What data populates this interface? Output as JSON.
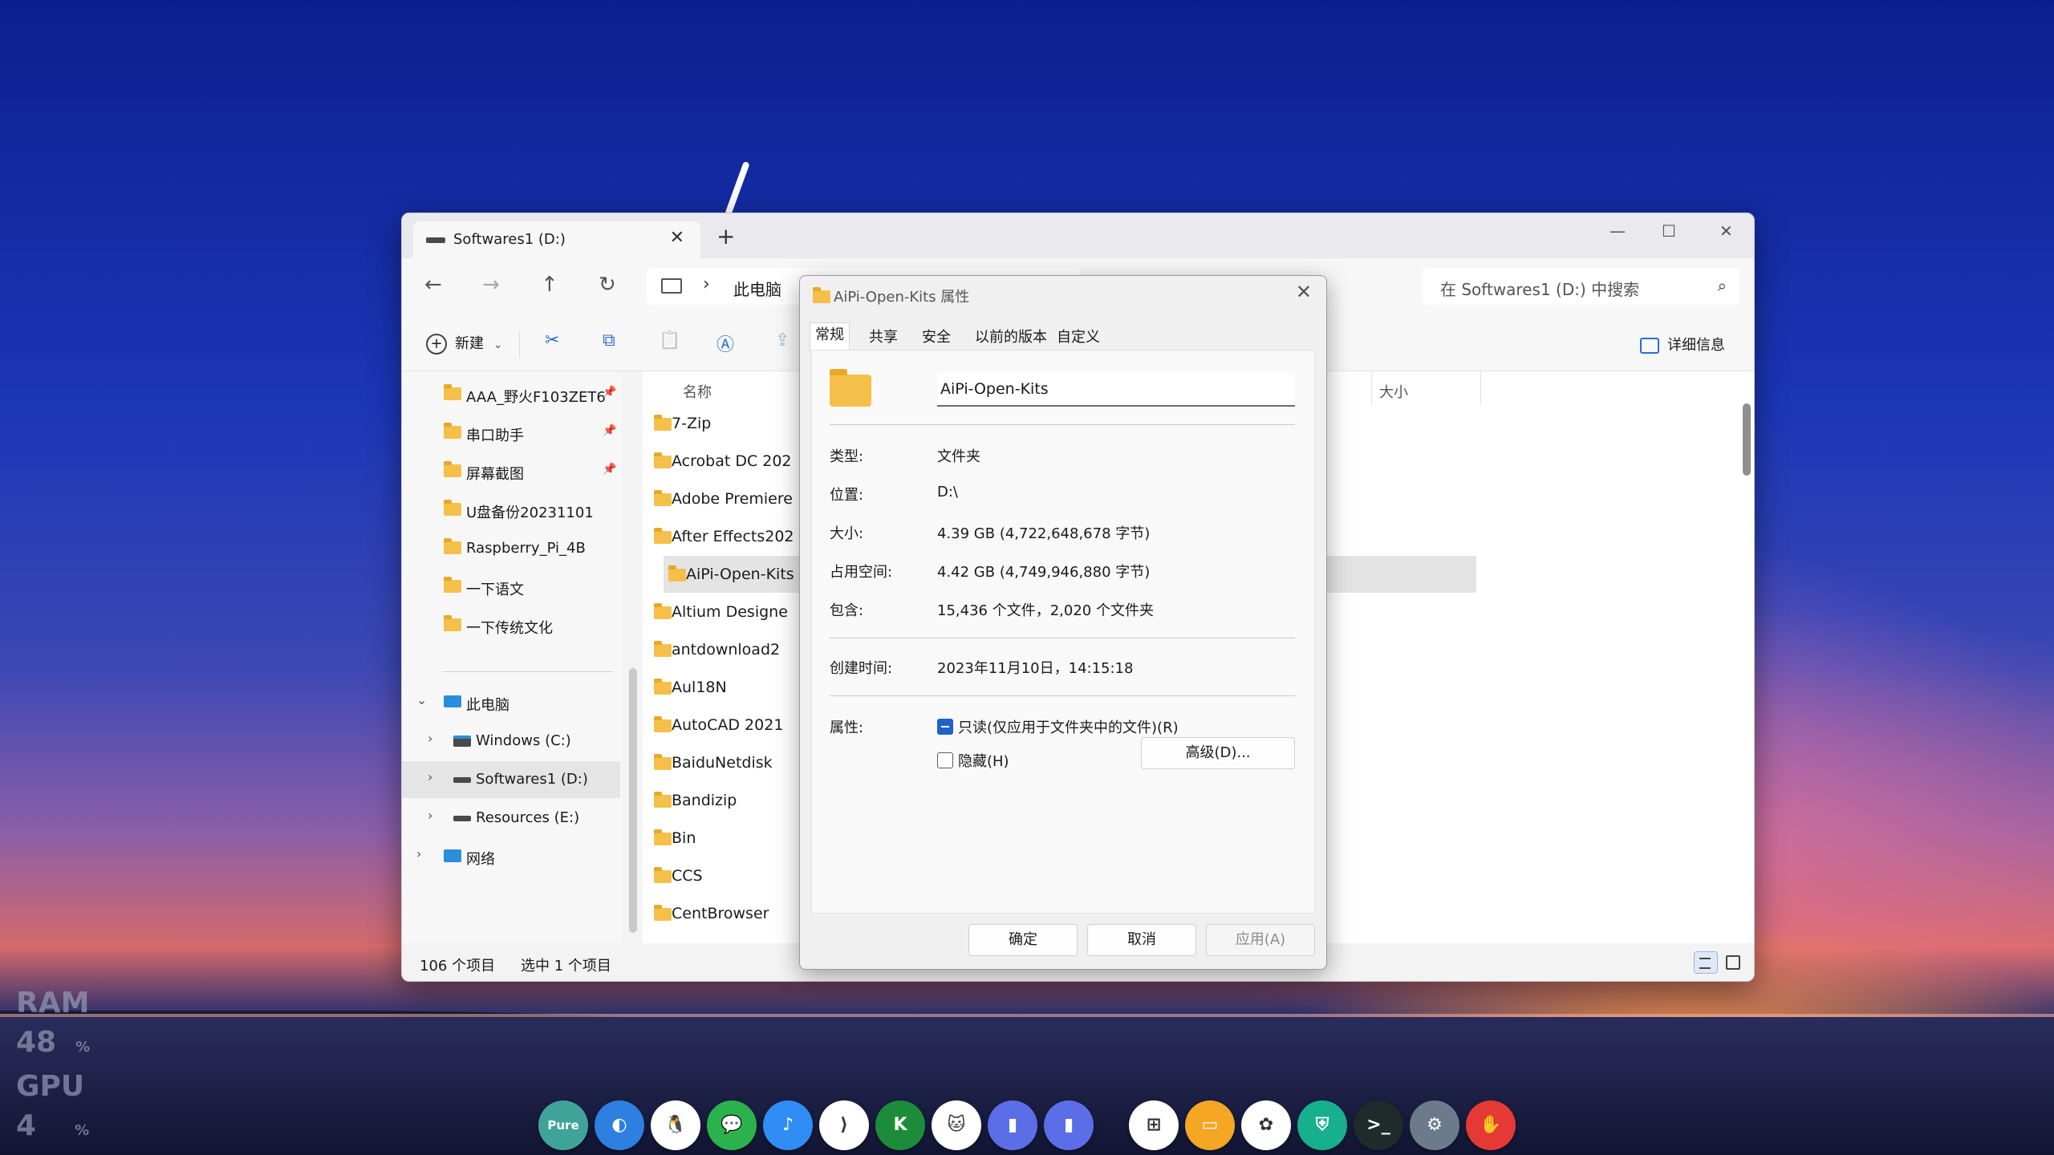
{
  "perf": {
    "ram_label": "RAM",
    "ram_value": "48",
    "ram_unit": "%",
    "gpu_label": "GPU",
    "gpu_value": "4",
    "gpu_unit": "%"
  },
  "tab": {
    "title": "Softwares1 (D:)",
    "close": "✕",
    "new": "+"
  },
  "window_controls": {
    "minimize": "—",
    "maximize": "☐",
    "close": "✕"
  },
  "nav": {
    "back": "←",
    "forward": "→",
    "up": "↑",
    "refresh": "↻"
  },
  "breadcrumb": {
    "sep": "›",
    "location": "此电脑"
  },
  "search": {
    "placeholder": "在 Softwares1 (D:) 中搜索",
    "icon": "⌕"
  },
  "toolbar": {
    "new_label": "新建",
    "new_plus": "+",
    "new_chevron": "⌄",
    "details_label": "详细信息",
    "cut": "✂",
    "copy": "⧉",
    "paste": "📋",
    "rename": "Ⓐ",
    "share": "⇪"
  },
  "sidebar": {
    "quick": [
      {
        "label": "AAA_野火F103ZET6",
        "pinned": true
      },
      {
        "label": "串口助手",
        "pinned": true
      },
      {
        "label": "屏幕截图",
        "pinned": true
      },
      {
        "label": "U盘备份20231101",
        "pinned": false
      },
      {
        "label": "Raspberry_Pi_4B",
        "pinned": false
      },
      {
        "label": "一下语文",
        "pinned": false
      },
      {
        "label": "一下传统文化",
        "pinned": false
      }
    ],
    "pin_glyph": "📌",
    "this_pc": "此电脑",
    "drives": [
      {
        "label": "Windows (C:)"
      },
      {
        "label": "Softwares1 (D:)",
        "selected": true
      },
      {
        "label": "Resources (E:)"
      }
    ],
    "network": "网络",
    "chev_right": "›",
    "chev_down": "⌄"
  },
  "columns": {
    "name": "名称",
    "size": "大小"
  },
  "files": [
    "7-Zip",
    "Acrobat DC 202",
    "Adobe Premiere",
    "After Effects202",
    "AiPi-Open-Kits",
    "Altium Designe",
    "antdownload2",
    "Aul18N",
    "AutoCAD 2021",
    "BaiduNetdisk",
    "Bandizip",
    "Bin",
    "CCS",
    "CentBrowser"
  ],
  "selected_file": "AiPi-Open-Kits",
  "status": {
    "count": "106 个项目",
    "selected": "选中 1 个项目"
  },
  "dialog": {
    "title": "AiPi-Open-Kits 属性",
    "close": "✕",
    "tabs": [
      "常规",
      "共享",
      "安全",
      "以前的版本",
      "自定义"
    ],
    "name": "AiPi-Open-Kits",
    "rows": [
      {
        "label": "类型:",
        "value": "文件夹"
      },
      {
        "label": "位置:",
        "value": "D:\\"
      },
      {
        "label": "大小:",
        "value": "4.39 GB (4,722,648,678 字节)"
      },
      {
        "label": "占用空间:",
        "value": "4.42 GB (4,749,946,880 字节)"
      },
      {
        "label": "包含:",
        "value": "15,436 个文件，2,020 个文件夹"
      }
    ],
    "created_label": "创建时间:",
    "created_value": "2023年11月10日，14:15:18",
    "attr_label": "属性:",
    "readonly_label": "只读(仅应用于文件夹中的文件)(R)",
    "hidden_label": "隐藏(H)",
    "advanced_button": "高级(D)...",
    "ok": "确定",
    "cancel": "取消",
    "apply": "应用(A)"
  },
  "dock": [
    {
      "name": "pure-app",
      "label": "Pure",
      "color": "#3fa39a"
    },
    {
      "name": "browser-app",
      "label": "◐",
      "color": "#2d7fe0"
    },
    {
      "name": "qq-app",
      "label": "🐧",
      "color": "#ffffff"
    },
    {
      "name": "wechat-app",
      "label": "💬",
      "color": "#2bb24c"
    },
    {
      "name": "music-app",
      "label": "♪",
      "color": "#2f8df5"
    },
    {
      "name": "vscode-app",
      "label": "⟩",
      "color": "#ffffff"
    },
    {
      "name": "kaspersky-app",
      "label": "K",
      "color": "#1d8c3a"
    },
    {
      "name": "cat-app",
      "label": "🐱",
      "color": "#ffffff"
    },
    {
      "name": "reader-app-1",
      "label": "▮",
      "color": "#5b6ee8"
    },
    {
      "name": "reader-app-2",
      "label": "▮",
      "color": "#5b6ee8"
    },
    {
      "name": "store-app",
      "label": "⊞",
      "color": "#ffffff"
    },
    {
      "name": "files-app",
      "label": "▭",
      "color": "#f5a623"
    },
    {
      "name": "paint-app",
      "label": "✿",
      "color": "#ffffff"
    },
    {
      "name": "security-app",
      "label": "⛨",
      "color": "#17b08f"
    },
    {
      "name": "terminal-app",
      "label": ">_",
      "color": "#1f2a2a"
    },
    {
      "name": "settings-app",
      "label": "⚙",
      "color": "#6b7b8c"
    },
    {
      "name": "red-app",
      "label": "✋",
      "color": "#e53935"
    }
  ]
}
